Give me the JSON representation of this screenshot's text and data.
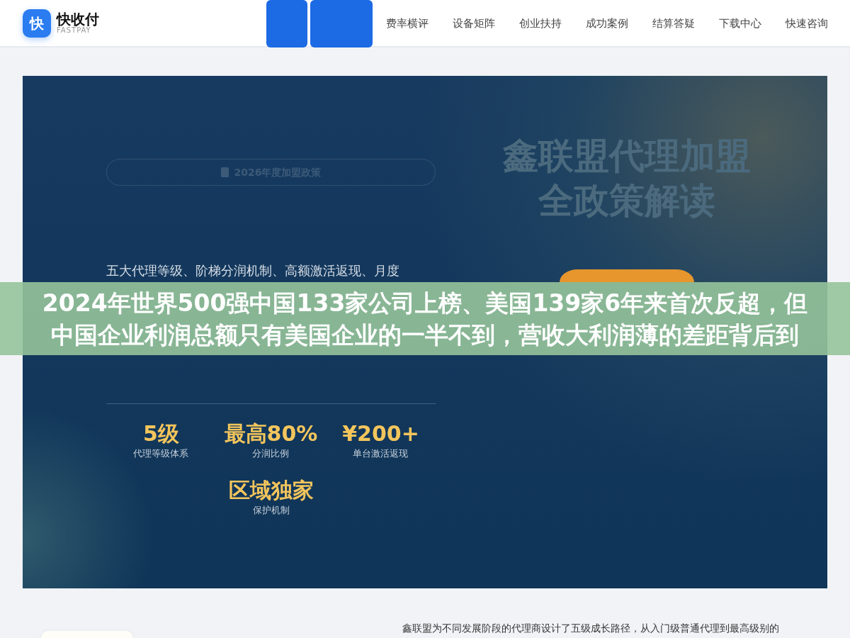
{
  "logo": {
    "mark": "快",
    "name": "快收付",
    "tagline": "FASTPAY"
  },
  "nav": [
    {
      "selected": true
    },
    {
      "selected": true
    },
    {
      "label": "费率横评",
      "selected": false
    },
    {
      "label": "设备矩阵",
      "selected": false
    },
    {
      "label": "创业扶持",
      "selected": false
    },
    {
      "label": "成功案例",
      "selected": false
    },
    {
      "label": "结算答疑",
      "selected": false
    },
    {
      "label": "下载中心",
      "selected": false
    },
    {
      "label": "快速咨询",
      "selected": false
    }
  ],
  "hero": {
    "badge": "2026年度加盟政策",
    "title_lines": [
      "鑫联盟代理加盟",
      "全政策解读"
    ],
    "intro": "五大代理等级、阶梯分润机制、高额激活返现、月度",
    "buttons": [
      {
        "kind": "primary"
      }
    ],
    "stats": [
      {
        "value": "5级",
        "label": "代理等级体系"
      },
      {
        "value": "最高80%",
        "label": "分润比例"
      },
      {
        "value": "¥200+",
        "label": "单台激活返现"
      },
      {
        "value": "区域独家",
        "label": "保护机制"
      }
    ]
  },
  "headline": {
    "lines": [
      "2024年世界500强中国133家公司上榜、美国139家6年来首次反超，但",
      "中国企业利润总额只有美国企业的一半不到，营收大利润薄的差距背后到"
    ]
  },
  "section": {
    "text": "鑫联盟为不同发展阶段的代理商设计了五级成长路径，从入门级普通代理到最高级别的"
  }
}
